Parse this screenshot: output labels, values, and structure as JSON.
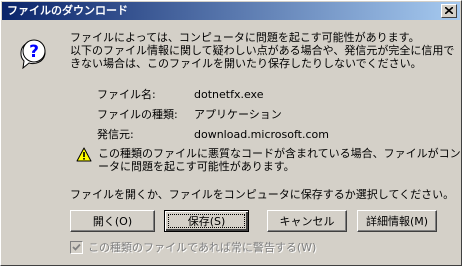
{
  "window": {
    "title": "ファイルのダウンロード",
    "icon": "question-icon"
  },
  "intro": {
    "lines": [
      "ファイルによっては、コンピュータに問題を起こす可能性があります。",
      "以下のファイル情報に関して疑わしい点がある場合や、発信元が完全に信用で",
      "きない場合は、このファイルを開いたり保存したりしないでください。"
    ]
  },
  "file_info": {
    "name_label": "ファイル名:",
    "name_value": "dotnetfx.exe",
    "type_label": "ファイルの種類:",
    "type_value": "アプリケーション",
    "source_label": "発信元:",
    "source_value": "download.microsoft.com"
  },
  "warning": {
    "icon": "warning-icon",
    "lines": [
      "この種類のファイルに悪質なコードが含まれている場合、ファイルがコンピュ",
      "ータに問題を起こす可能性があります。"
    ]
  },
  "prompt": "ファイルを開くか、ファイルをコンピュータに保存するか選択してください。",
  "buttons": {
    "open": "開く(O)",
    "save": "保存(S)",
    "cancel": "キャンセル",
    "details": "詳細情報(M)"
  },
  "checkbox": {
    "label": "この種類のファイルであれば常に警告する(W)",
    "checked": true,
    "enabled": false
  },
  "colors": {
    "title_start": "#0a246a",
    "title_end": "#a6caf0",
    "face": "#d4d0c8"
  }
}
